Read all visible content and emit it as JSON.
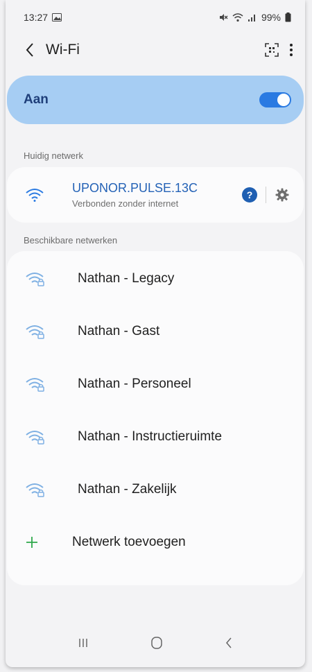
{
  "status": {
    "time": "13:27",
    "battery": "99%"
  },
  "header": {
    "title": "Wi-Fi"
  },
  "toggle": {
    "label": "Aan",
    "on": true
  },
  "current_section": {
    "label": "Huidig netwerk"
  },
  "current_network": {
    "name": "UPONOR.PULSE.13C",
    "status": "Verbonden zonder internet"
  },
  "available_section": {
    "label": "Beschikbare netwerken"
  },
  "networks": [
    {
      "name": "Nathan - Legacy"
    },
    {
      "name": "Nathan - Gast"
    },
    {
      "name": "Nathan - Personeel"
    },
    {
      "name": "Nathan - Instructieruimte"
    },
    {
      "name": "Nathan - Zakelijk"
    }
  ],
  "add_network": {
    "label": "Netwerk toevoegen"
  },
  "colors": {
    "accent": "#2a7ae2",
    "banner": "#a6cdf3",
    "wifi_current": "#2a7ae2",
    "wifi_locked": "#6ea7e0"
  },
  "icons": {
    "status": [
      "gallery-icon",
      "mute-icon",
      "wifi-icon",
      "signal-icon",
      "battery-icon"
    ],
    "header": [
      "back-icon",
      "qr-scan-icon",
      "more-icon"
    ],
    "nav": [
      "recents-icon",
      "home-icon",
      "back-nav-icon"
    ]
  }
}
